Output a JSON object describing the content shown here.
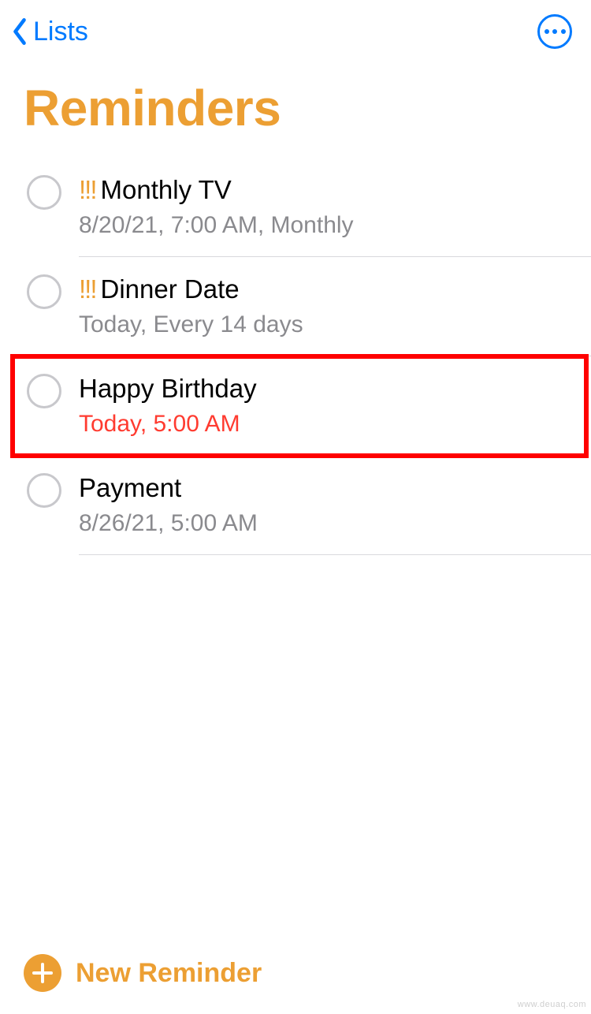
{
  "nav": {
    "back_label": "Lists"
  },
  "page_title": "Reminders",
  "reminders": [
    {
      "priority": "!!!",
      "title": "Monthly  TV",
      "subtitle": "8/20/21, 7:00 AM, Monthly",
      "overdue": false,
      "highlighted": false
    },
    {
      "priority": "!!!",
      "title": "Dinner Date",
      "subtitle": "Today, Every 14 days",
      "overdue": false,
      "highlighted": false
    },
    {
      "priority": "",
      "title": "Happy Birthday",
      "subtitle": "Today, 5:00 AM",
      "overdue": true,
      "highlighted": true
    },
    {
      "priority": "",
      "title": "Payment",
      "subtitle": "8/26/21, 5:00 AM",
      "overdue": false,
      "highlighted": false
    }
  ],
  "footer": {
    "new_label": "New Reminder"
  },
  "watermark": "www.deuaq.com"
}
